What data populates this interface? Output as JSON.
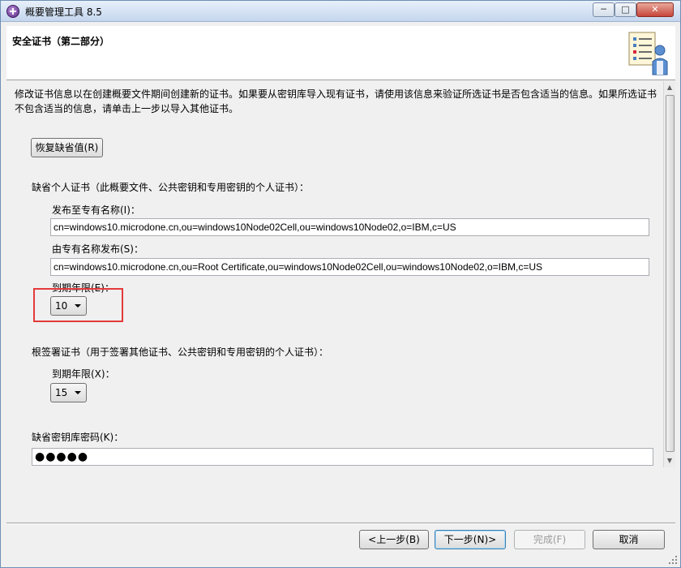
{
  "window": {
    "title": "概要管理工具 8.5",
    "minimize": "─",
    "maximize": "□",
    "close": "✕"
  },
  "header": {
    "title": "安全证书（第二部分）",
    "icon": "wizard-checklist-icon"
  },
  "description": "修改证书信息以在创建概要文件期间创建新的证书。如果要从密钥库导入现有证书，请使用该信息来验证所选证书是否包含适当的信息。如果所选证书不包含适当的信息，请单击上一步以导入其他证书。",
  "restore_defaults_label": "恢复缺省值(R)",
  "personal_cert": {
    "heading": "缺省个人证书（此概要文件、公共密钥和专用密钥的个人证书）：",
    "issued_to_label": "发布至专有名称(I)：",
    "issued_to_value": "cn=windows10.microdone.cn,ou=windows10Node02Cell,ou=windows10Node02,o=IBM,c=US",
    "issued_by_label": "由专有名称发布(S)：",
    "issued_by_value": "cn=windows10.microdone.cn,ou=Root Certificate,ou=windows10Node02Cell,ou=windows10Node02,o=IBM,c=US",
    "expiration_label": "到期年限(E)：",
    "expiration_value": "10"
  },
  "root_cert": {
    "heading": "根签署证书（用于签署其他证书、公共密钥和专用密钥的个人证书）：",
    "expiration_label": "到期年限(X)：",
    "expiration_value": "15"
  },
  "keystore": {
    "password_label": "缺省密钥库密码(K)：",
    "password_value": "●●●●●"
  },
  "buttons": {
    "back": "<上一步(B)",
    "next": "下一步(N)>",
    "finish": "完成(F)",
    "cancel": "取消"
  },
  "colors": {
    "highlight": "#e43a3a",
    "accent": "#3c7fb1"
  }
}
